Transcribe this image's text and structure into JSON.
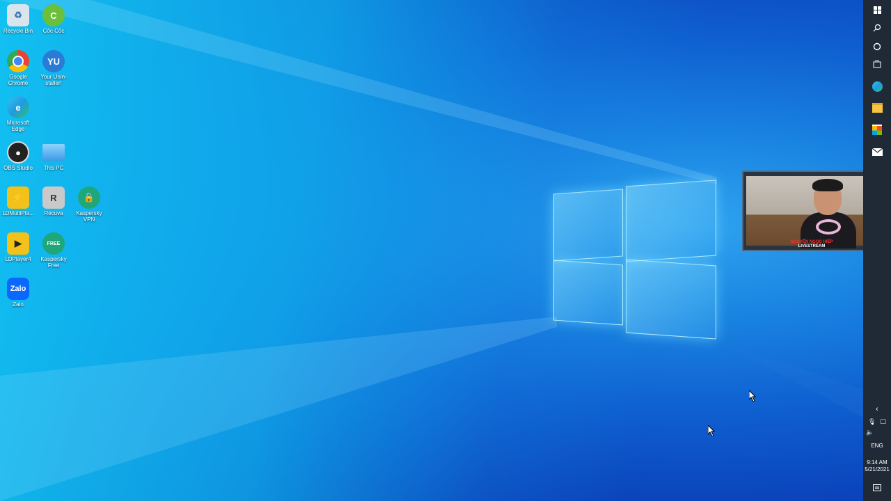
{
  "desktop": {
    "icons": [
      {
        "label": "Recycle Bin",
        "icon": "recycle-bin-icon",
        "color": "#d9e4ec"
      },
      {
        "label": "Cốc Cốc",
        "icon": "coccoc-icon",
        "color": "#6cbf3a"
      },
      {
        "label": "Google Chrome",
        "icon": "chrome-icon",
        "color": "#e94335"
      },
      {
        "label": "Your Unin-staller!",
        "icon": "uninstaller-icon",
        "color": "#2a7bd6"
      },
      {
        "label": "Microsoft Edge",
        "icon": "edge-icon",
        "color": "#1e9be0"
      },
      {
        "label": "OBS Studio",
        "icon": "obs-icon",
        "color": "#222222"
      },
      {
        "label": "This PC",
        "icon": "this-pc-icon",
        "color": "#5ab4f0"
      },
      {
        "label": "LDMultiPla...",
        "icon": "ldmultiplayer-icon",
        "color": "#f2c21a"
      },
      {
        "label": "Recuva",
        "icon": "recuva-icon",
        "color": "#c9c9c9"
      },
      {
        "label": "Kaspersky VPN",
        "icon": "kaspersky-vpn-icon",
        "color": "#1fa77a"
      },
      {
        "label": "LDPlayer4",
        "icon": "ldplayer-icon",
        "color": "#f2c21a"
      },
      {
        "label": "Kaspersky Free",
        "icon": "kaspersky-free-icon",
        "color": "#1fa77a"
      },
      {
        "label": "Zalo",
        "icon": "zalo-icon",
        "color": "#0a68ff"
      }
    ]
  },
  "taskbar": {
    "items": [
      {
        "icon": "start-icon"
      },
      {
        "icon": "search-icon"
      },
      {
        "icon": "cortana-icon"
      },
      {
        "icon": "task-view-icon"
      },
      {
        "icon": "edge-taskbar-icon"
      },
      {
        "icon": "file-explorer-icon"
      },
      {
        "icon": "store-icon"
      },
      {
        "icon": "mail-icon"
      }
    ],
    "tray": {
      "language": "ENG",
      "time": "9:14 AM",
      "date": "5/21/2021"
    }
  },
  "webcam": {
    "banner_name": "NGUYỄN NGỌC HIỆP",
    "banner_sub": "LIVESTREAM"
  }
}
